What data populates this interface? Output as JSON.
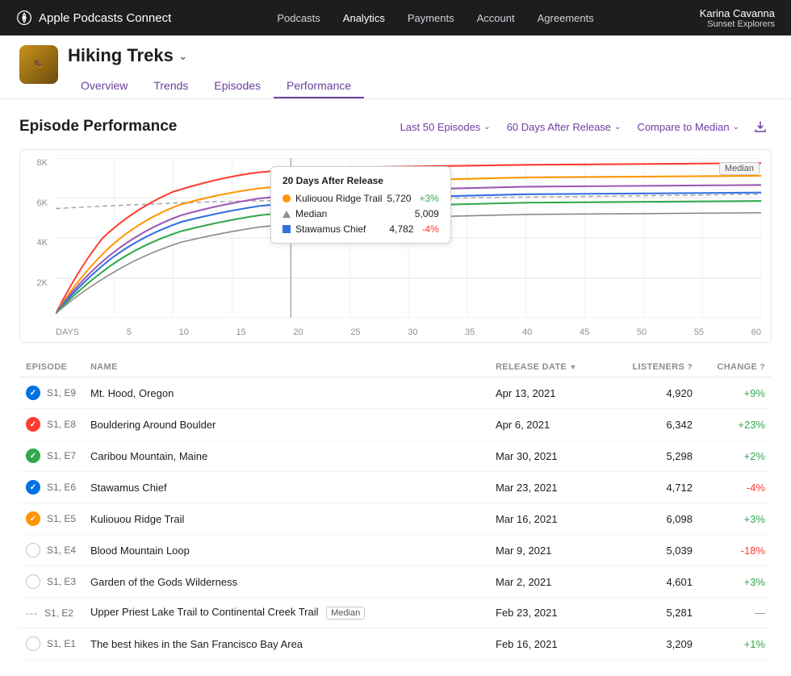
{
  "app": {
    "name": "Apple Podcasts Connect",
    "nav_items": [
      "Podcasts",
      "Analytics",
      "Payments",
      "Account",
      "Agreements"
    ],
    "active_nav": "Analytics",
    "user_name": "Karina Cavanna",
    "podcast_name": "Sunset Explorers"
  },
  "podcast": {
    "name": "Hiking Treks",
    "tabs": [
      "Overview",
      "Trends",
      "Episodes",
      "Performance"
    ],
    "active_tab": "Performance"
  },
  "section": {
    "title": "Episode Performance",
    "filters": {
      "episodes_label": "Last 50 Episodes",
      "days_label": "60 Days After Release",
      "compare_label": "Compare to Median"
    }
  },
  "chart": {
    "y_labels": [
      "8K",
      "6K",
      "4K",
      "2K",
      ""
    ],
    "x_labels": [
      "DAYS",
      "5",
      "10",
      "15",
      "20",
      "25",
      "30",
      "35",
      "40",
      "45",
      "50",
      "55",
      "60"
    ],
    "median_label": "Median",
    "tooltip": {
      "title": "20 Days After Release",
      "rows": [
        {
          "type": "dot",
          "color": "#ff9500",
          "label": "Kuliouou Ridge Trail",
          "value": "5,720",
          "change": "+3%",
          "positive": true
        },
        {
          "type": "triangle",
          "color": "#8e8e93",
          "label": "Median",
          "value": "5,009",
          "change": "",
          "positive": null
        },
        {
          "type": "square",
          "color": "#3370e0",
          "label": "Stawamus Chief",
          "value": "4,782",
          "change": "-4%",
          "positive": false
        }
      ]
    }
  },
  "table": {
    "headers": [
      "EPISODE",
      "NAME",
      "RELEASE DATE",
      "LISTENERS",
      "CHANGE"
    ],
    "rows": [
      {
        "status": "blue_check",
        "episode": "S1, E9",
        "name": "Mt. Hood, Oregon",
        "date": "Apr 13, 2021",
        "listeners": "4,920",
        "change": "+9%",
        "change_positive": true,
        "median": false
      },
      {
        "status": "red_check",
        "episode": "S1, E8",
        "name": "Bouldering Around Boulder",
        "date": "Apr 6, 2021",
        "listeners": "6,342",
        "change": "+23%",
        "change_positive": true,
        "median": false
      },
      {
        "status": "green_check",
        "episode": "S1, E7",
        "name": "Caribou Mountain, Maine",
        "date": "Mar 30, 2021",
        "listeners": "5,298",
        "change": "+2%",
        "change_positive": true,
        "median": false
      },
      {
        "status": "blue_check",
        "episode": "S1, E6",
        "name": "Stawamus Chief",
        "date": "Mar 23, 2021",
        "listeners": "4,712",
        "change": "-4%",
        "change_positive": false,
        "median": false
      },
      {
        "status": "orange_check",
        "episode": "S1, E5",
        "name": "Kuliouou Ridge Trail",
        "date": "Mar 16, 2021",
        "listeners": "6,098",
        "change": "+3%",
        "change_positive": true,
        "median": false
      },
      {
        "status": "empty",
        "episode": "S1, E4",
        "name": "Blood Mountain Loop",
        "date": "Mar 9, 2021",
        "listeners": "5,039",
        "change": "-18%",
        "change_positive": false,
        "median": false
      },
      {
        "status": "empty",
        "episode": "S1, E3",
        "name": "Garden of the Gods Wilderness",
        "date": "Mar 2, 2021",
        "listeners": "4,601",
        "change": "+3%",
        "change_positive": true,
        "median": false
      },
      {
        "status": "dashes",
        "episode": "S1, E2",
        "name": "Upper Priest Lake Trail to Continental Creek Trail",
        "date": "Feb 23, 2021",
        "listeners": "5,281",
        "change": "—",
        "change_positive": null,
        "median": true
      },
      {
        "status": "empty",
        "episode": "S1, E1",
        "name": "The best hikes in the San Francisco Bay Area",
        "date": "Feb 16, 2021",
        "listeners": "3,209",
        "change": "+1%",
        "change_positive": true,
        "median": false
      }
    ]
  }
}
